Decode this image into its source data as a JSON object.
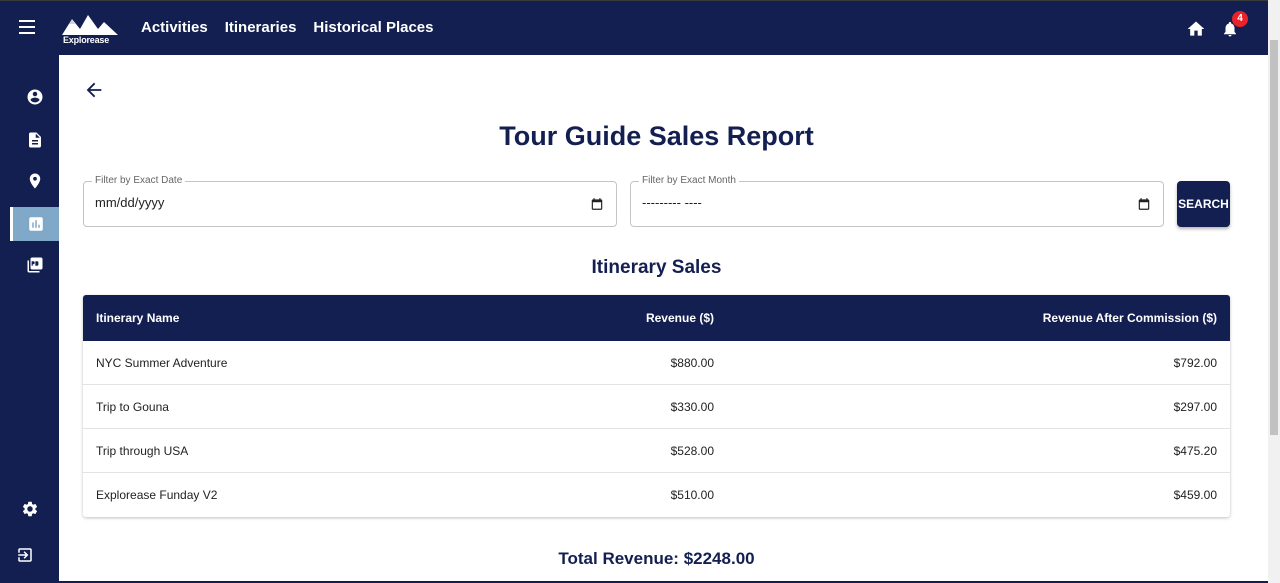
{
  "app": {
    "logo_text": "Explorease",
    "nav": [
      "Activities",
      "Itineraries",
      "Historical Places"
    ],
    "notification_count": "4"
  },
  "sidebar": {
    "items": [
      {
        "icon": "account-circle-icon"
      },
      {
        "icon": "document-icon"
      },
      {
        "icon": "location-pin-icon"
      },
      {
        "icon": "bar-chart-icon",
        "active": true
      },
      {
        "icon": "pdf-collection-icon"
      }
    ],
    "bottom": [
      {
        "icon": "gear-icon"
      },
      {
        "icon": "logout-icon"
      }
    ]
  },
  "page": {
    "title": "Tour Guide Sales Report",
    "filter_date_label": "Filter by Exact Date",
    "filter_date_value": "mm/dd/yyyy",
    "filter_month_label": "Filter by Exact Month",
    "filter_month_value": "--------- ----",
    "search_label": "SEARCH",
    "section_title": "Itinerary Sales",
    "total": "Total Revenue: $2248.00"
  },
  "table": {
    "headers": [
      "Itinerary Name",
      "Revenue ($)",
      "Revenue After Commission ($)"
    ],
    "rows": [
      [
        "NYC Summer Adventure",
        "$880.00",
        "$792.00"
      ],
      [
        "Trip to Gouna",
        "$330.00",
        "$297.00"
      ],
      [
        "Trip through USA",
        "$528.00",
        "$475.20"
      ],
      [
        "Explorease Funday V2",
        "$510.00",
        "$459.00"
      ]
    ]
  },
  "colors": {
    "primary": "#131f51",
    "sidebar_active": "#7fa8c9",
    "badge": "#e8232a"
  }
}
